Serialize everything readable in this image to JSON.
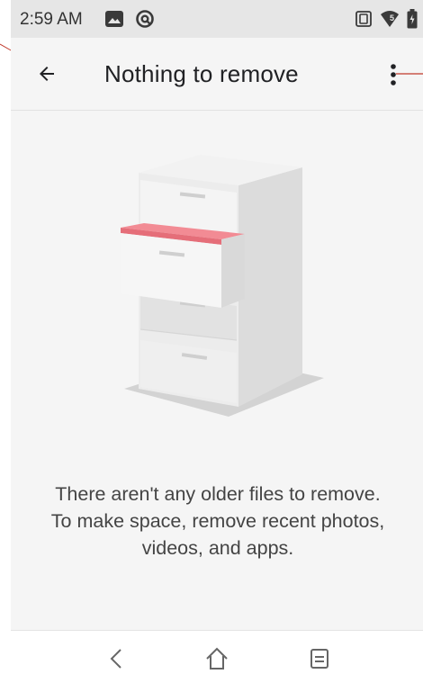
{
  "status_bar": {
    "time": "2:59 AM",
    "left_icons": [
      "image-notification-icon",
      "sync-notification-icon"
    ],
    "right_icons": [
      "vibrate-icon",
      "wifi-icon",
      "battery-icon"
    ],
    "wifi_badge": "5"
  },
  "app_bar": {
    "title": "Nothing to remove",
    "back_icon": "arrow-back-icon",
    "more_icon": "more-vert-icon"
  },
  "illustration": {
    "description_icon": "filing-cabinet-icon",
    "accent_color": "#f28b94"
  },
  "message": {
    "text": "There aren't any older files to remove. To make space, remove recent photos, videos, and apps."
  },
  "nav_bar": {
    "icons": [
      "back-nav-icon",
      "home-nav-icon",
      "recents-nav-icon"
    ]
  },
  "colors": {
    "annotation_red": "#c0392b"
  }
}
